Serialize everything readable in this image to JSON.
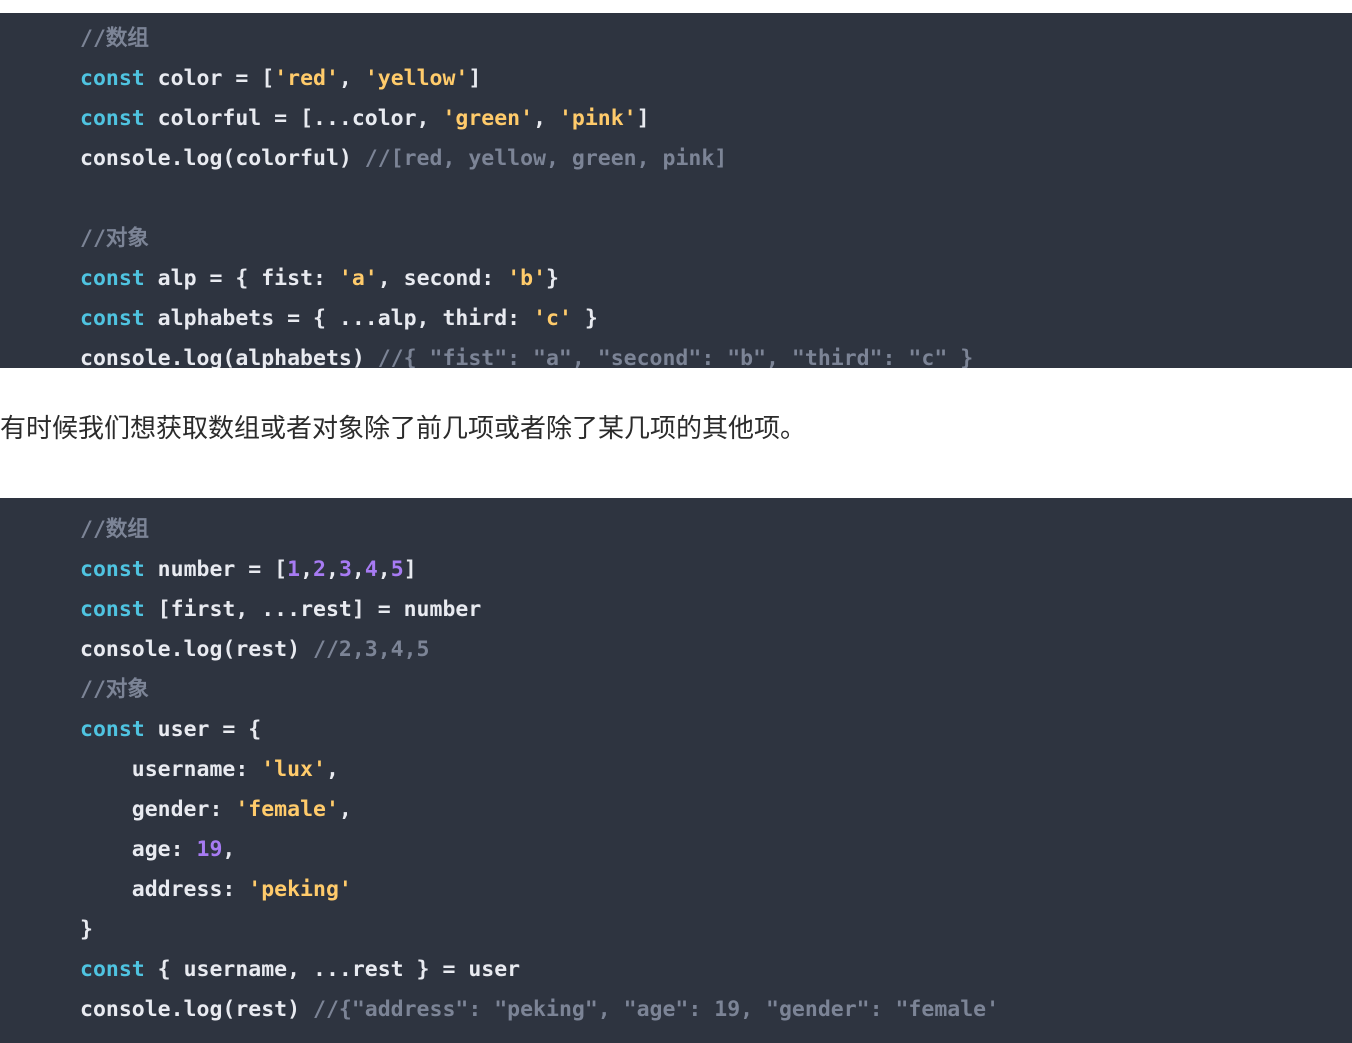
{
  "theme": {
    "code_background": "#2e3440",
    "page_background": "#ffffff",
    "keyword_color": "#4fc3e0",
    "string_color": "#ffcb6b",
    "number_color": "#a77bf3",
    "comment_color": "#7c8496",
    "plain_color": "#e8eaf0",
    "paragraph_color": "#2b2b2b"
  },
  "code_block_1": {
    "language": "javascript",
    "lines": [
      {
        "id": "b1l1",
        "tokens": [
          {
            "t": "//数组",
            "c": "cmt"
          }
        ]
      },
      {
        "id": "b1l2",
        "tokens": [
          {
            "t": "const",
            "c": "kw"
          },
          {
            "t": " color = [",
            "c": "txt"
          },
          {
            "t": "'red'",
            "c": "str"
          },
          {
            "t": ", ",
            "c": "txt"
          },
          {
            "t": "'yellow'",
            "c": "str"
          },
          {
            "t": "]",
            "c": "txt"
          }
        ]
      },
      {
        "id": "b1l3",
        "tokens": [
          {
            "t": "const",
            "c": "kw"
          },
          {
            "t": " colorful = [...color, ",
            "c": "txt"
          },
          {
            "t": "'green'",
            "c": "str"
          },
          {
            "t": ", ",
            "c": "txt"
          },
          {
            "t": "'pink'",
            "c": "str"
          },
          {
            "t": "]",
            "c": "txt"
          }
        ]
      },
      {
        "id": "b1l4",
        "tokens": [
          {
            "t": "console.log(colorful) ",
            "c": "txt"
          },
          {
            "t": "//[red, yellow, green, pink]",
            "c": "cmt"
          }
        ]
      },
      {
        "id": "b1l5",
        "tokens": [
          {
            "t": " ",
            "c": "txt"
          }
        ]
      },
      {
        "id": "b1l6",
        "tokens": [
          {
            "t": "//对象",
            "c": "cmt"
          }
        ]
      },
      {
        "id": "b1l7",
        "tokens": [
          {
            "t": "const",
            "c": "kw"
          },
          {
            "t": " alp = { fist: ",
            "c": "txt"
          },
          {
            "t": "'a'",
            "c": "str"
          },
          {
            "t": ", second: ",
            "c": "txt"
          },
          {
            "t": "'b'",
            "c": "str"
          },
          {
            "t": "}",
            "c": "txt"
          }
        ]
      },
      {
        "id": "b1l8",
        "tokens": [
          {
            "t": "const",
            "c": "kw"
          },
          {
            "t": " alphabets = { ...alp, third: ",
            "c": "txt"
          },
          {
            "t": "'c'",
            "c": "str"
          },
          {
            "t": " }",
            "c": "txt"
          }
        ]
      },
      {
        "id": "b1l9",
        "tokens": [
          {
            "t": "console.log(alphabets) ",
            "c": "txt"
          },
          {
            "t": "//{ \"fist\": \"a\", \"second\": \"b\", \"third\": \"c\" }",
            "c": "cmt"
          }
        ]
      }
    ]
  },
  "paragraph": {
    "text": "有时候我们想获取数组或者对象除了前几项或者除了某几项的其他项。"
  },
  "code_block_2": {
    "language": "javascript",
    "lines": [
      {
        "id": "b2l1",
        "tokens": [
          {
            "t": "//数组",
            "c": "cmt"
          }
        ]
      },
      {
        "id": "b2l2",
        "tokens": [
          {
            "t": "const",
            "c": "kw"
          },
          {
            "t": " number = [",
            "c": "txt"
          },
          {
            "t": "1",
            "c": "num"
          },
          {
            "t": ",",
            "c": "txt"
          },
          {
            "t": "2",
            "c": "num"
          },
          {
            "t": ",",
            "c": "txt"
          },
          {
            "t": "3",
            "c": "num"
          },
          {
            "t": ",",
            "c": "txt"
          },
          {
            "t": "4",
            "c": "num"
          },
          {
            "t": ",",
            "c": "txt"
          },
          {
            "t": "5",
            "c": "num"
          },
          {
            "t": "]",
            "c": "txt"
          }
        ]
      },
      {
        "id": "b2l3",
        "tokens": [
          {
            "t": "const",
            "c": "kw"
          },
          {
            "t": " [first, ...rest] = number",
            "c": "txt"
          }
        ]
      },
      {
        "id": "b2l4",
        "tokens": [
          {
            "t": "console.log(rest) ",
            "c": "txt"
          },
          {
            "t": "//2,3,4,5",
            "c": "cmt"
          }
        ]
      },
      {
        "id": "b2l5",
        "tokens": [
          {
            "t": "//对象",
            "c": "cmt"
          }
        ]
      },
      {
        "id": "b2l6",
        "tokens": [
          {
            "t": "const",
            "c": "kw"
          },
          {
            "t": " user = {",
            "c": "txt"
          }
        ]
      },
      {
        "id": "b2l7",
        "tokens": [
          {
            "t": "    username: ",
            "c": "txt"
          },
          {
            "t": "'lux'",
            "c": "str"
          },
          {
            "t": ",",
            "c": "txt"
          }
        ]
      },
      {
        "id": "b2l8",
        "tokens": [
          {
            "t": "    gender: ",
            "c": "txt"
          },
          {
            "t": "'female'",
            "c": "str"
          },
          {
            "t": ",",
            "c": "txt"
          }
        ]
      },
      {
        "id": "b2l9",
        "tokens": [
          {
            "t": "    age: ",
            "c": "txt"
          },
          {
            "t": "19",
            "c": "num"
          },
          {
            "t": ",",
            "c": "txt"
          }
        ]
      },
      {
        "id": "b2l10",
        "tokens": [
          {
            "t": "    address: ",
            "c": "txt"
          },
          {
            "t": "'peking'",
            "c": "str"
          }
        ]
      },
      {
        "id": "b2l11",
        "tokens": [
          {
            "t": "}",
            "c": "txt"
          }
        ]
      },
      {
        "id": "b2l12",
        "tokens": [
          {
            "t": "const",
            "c": "kw"
          },
          {
            "t": " { username, ...rest } = user",
            "c": "txt"
          }
        ]
      },
      {
        "id": "b2l13",
        "tokens": [
          {
            "t": "console.log(rest) ",
            "c": "txt"
          },
          {
            "t": "//{\"address\": \"peking\", \"age\": 19, \"gender\": \"female'",
            "c": "cmt"
          }
        ]
      }
    ]
  }
}
